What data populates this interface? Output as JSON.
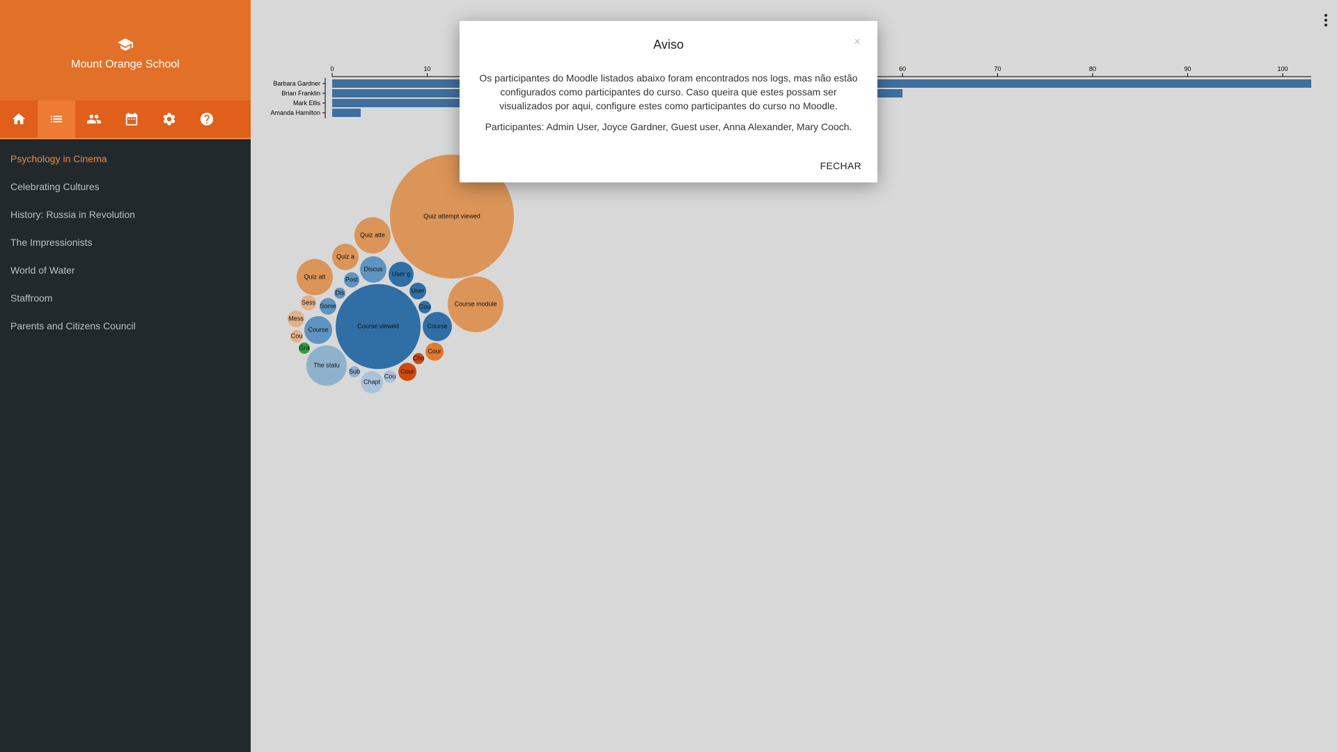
{
  "sidebar": {
    "school_name": "Mount Orange School",
    "icons": [
      "home-icon",
      "list-icon",
      "people-icon",
      "calendar-icon",
      "gear-icon",
      "help-icon"
    ],
    "active_icon": "list-icon",
    "courses": [
      {
        "label": "Psychology in Cinema",
        "active": true
      },
      {
        "label": "Celebrating Cultures",
        "active": false
      },
      {
        "label": "History: Russia in Revolution",
        "active": false
      },
      {
        "label": "The Impressionists",
        "active": false
      },
      {
        "label": "World of Water",
        "active": false
      },
      {
        "label": "Staffroom",
        "active": false
      },
      {
        "label": "Parents and Citizens Council",
        "active": false
      }
    ],
    "colors": {
      "header": "#e37027",
      "icon_bar": "#e05f1b",
      "background": "#21292d",
      "active_course": "#f08a3e"
    }
  },
  "chart_data": [
    {
      "type": "bar",
      "orientation": "horizontal",
      "categories": [
        "Barbara Gardner",
        "Brian Franklin",
        "Mark Ellis",
        "Amanda Hamilton"
      ],
      "values": [
        103,
        60,
        55,
        3
      ],
      "xlim": [
        0,
        103
      ],
      "xticks": [
        0,
        10,
        20,
        30,
        40,
        50,
        60,
        70,
        80,
        90,
        100
      ],
      "color": "#3e6f9f"
    },
    {
      "type": "bubble",
      "labels_note": "bubble labels as printed (truncated)",
      "bubbles": [
        {
          "label": "Quiz attempt viewed",
          "value": 100,
          "color": "#db9558"
        },
        {
          "label": "Course viewed",
          "value": 48,
          "color": "#2f6fa5"
        },
        {
          "label": "Course module",
          "value": 19,
          "color": "#db9558"
        },
        {
          "label": "The statu",
          "value": 10.5,
          "color": "#8fb2cc"
        },
        {
          "label": "Quiz att",
          "value": 8,
          "color": "#db9558"
        },
        {
          "label": "Quiz att",
          "value": 8,
          "color": "#db9558"
        },
        {
          "label": "Quiz atte",
          "value": 8,
          "color": "#db9558"
        },
        {
          "label": "Course",
          "value": 5,
          "color": "#5e94c0"
        },
        {
          "label": "Course",
          "value": 5.5,
          "color": "#2f6fa5"
        },
        {
          "label": "Discus",
          "value": 4.5,
          "color": "#5e94c0"
        },
        {
          "label": "User g",
          "value": 4,
          "color": "#2f6fa5"
        },
        {
          "label": "Quiz a",
          "value": 4.5,
          "color": "#db9558"
        },
        {
          "label": "Chapt",
          "value": 3.2,
          "color": "#a9c2dc"
        },
        {
          "label": "Cour",
          "value": 2.6,
          "color": "#df7b2e"
        },
        {
          "label": "Cour",
          "value": 2.6,
          "color": "#cf4a0f"
        },
        {
          "label": "User",
          "value": 2.2,
          "color": "#2f6fa5"
        },
        {
          "label": "Some",
          "value": 2.2,
          "color": "#5e94c0"
        },
        {
          "label": "Post",
          "value": 2,
          "color": "#5e94c0"
        },
        {
          "label": "Sess",
          "value": 2,
          "color": "#e3b189"
        },
        {
          "label": "Mess",
          "value": 2,
          "color": "#e3b189"
        },
        {
          "label": "Cou",
          "value": 1.1,
          "color": "#2f6fa5"
        },
        {
          "label": "Cou",
          "value": 1.1,
          "color": "#a9c2dc"
        },
        {
          "label": "Sub",
          "value": 1,
          "color": "#8fb2cc"
        },
        {
          "label": "Dis",
          "value": 1,
          "color": "#5e94c0"
        },
        {
          "label": "Cou",
          "value": 1,
          "color": "#e3b189"
        },
        {
          "label": "Gra",
          "value": 1,
          "color": "#2e9c3c"
        },
        {
          "label": "Cho",
          "value": 0.9,
          "color": "#cf4a0f"
        }
      ]
    }
  ],
  "modal": {
    "title": "Aviso",
    "close_symbol": "×",
    "message": "Os participantes do Moodle listados abaixo foram encontrados nos logs, mas não estão configurados como participantes do curso. Caso queira que estes possam ser visualizados por aqui, configure estes como participantes do curso no Moodle.",
    "participants": "Participantes: Admin User, Joyce Gardner, Guest user, Anna Alexander, Mary Cooch.",
    "close_button": "FECHAR"
  }
}
